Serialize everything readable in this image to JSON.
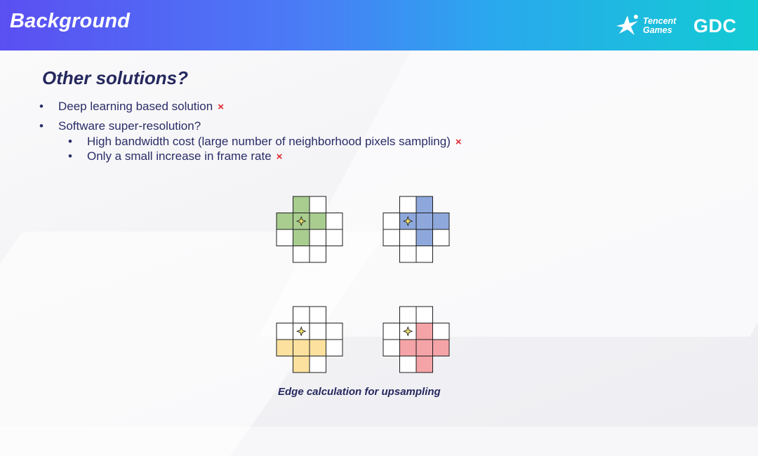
{
  "header": {
    "title": "Background",
    "brand_line1": "Tencent",
    "brand_line2": "Games",
    "conference_logo": "GDC"
  },
  "slide": {
    "heading": "Other solutions?",
    "bullets": [
      {
        "text": "Deep learning based solution",
        "mark": "×"
      },
      {
        "text": "Software super-resolution?",
        "mark": ""
      },
      {
        "text": "High bandwidth cost (large number of neighborhood pixels sampling)",
        "mark": "×"
      },
      {
        "text": "Only a small increase in frame rate",
        "mark": "×"
      }
    ],
    "caption": "Edge calculation for upsampling"
  },
  "colors": {
    "header_start": "#5b4ff2",
    "header_end": "#12cbd3",
    "text": "#2a2d66",
    "cross": "#e0262e",
    "green": "#a8cd8f",
    "blue": "#8ea8dc",
    "yellow": "#fce19e",
    "red": "#f4a3a7"
  },
  "icons": [
    "tencent-logo-icon",
    "sparkle-icon"
  ]
}
